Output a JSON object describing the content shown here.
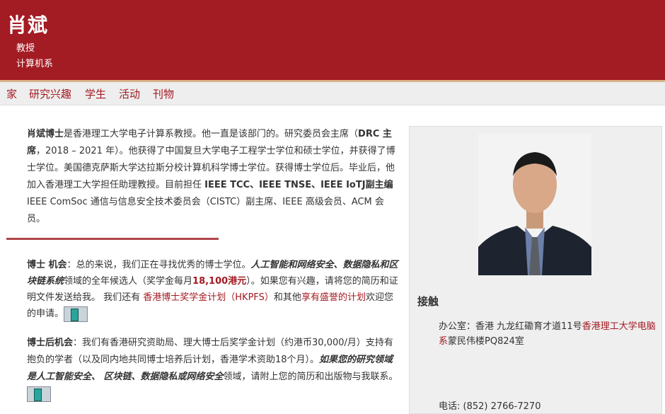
{
  "header": {
    "name": "肖斌",
    "title": "教授",
    "department": "计算机系"
  },
  "nav": [
    "家",
    "研究兴趣",
    "学生",
    "活动",
    "刊物"
  ],
  "bio": {
    "name_bold": "肖斌博士",
    "t1": "是香港理工大学电子计算系教授。他一直是该部门的。研究委员会主席（",
    "drc": "DRC 主席",
    "t2": "，2018 – 2021 年）。他获得了中国复旦大学电子工程学士学位和硕士学位，并获得了博士学位。美国德克萨斯大学达拉斯分校计算机科学博士学位。获得博士学位后。毕业后，他加入香港理工大学担任助理教授。目前担任 ",
    "ieee": "IEEE TCC、IEEE TNSE、IEEE IoTJ副主编",
    "t3": "IEEE ComSoc 通信与信息安全技术委员会（CISTC）副主席、IEEE 高级会员、ACM 会员。"
  },
  "phd": {
    "label": "博士 机会",
    "t1": "：总的来说，我们正在寻找优秀的博士学位。",
    "emph": "人工智能和网络安全、数据隐私和区块链系统",
    "t2": "领域的全年候选人（奖学金每月",
    "amount": "18,100港元",
    "t3": "）。如果您有兴趣，请将您的简历和证明文件发送给我。 我们还有 ",
    "link1": "香港博士奖学金计划（HKPFS）",
    "t4": "和其他",
    "link2": "享有盛誉的计划",
    "t5": "欢迎您的申请。"
  },
  "postdoc": {
    "label": "博士后机会",
    "t1": "：我们有香港研究资助局、理大博士后奖学金计划（约港币30,000/月）支持有抱负的学者（以及同内地共同博士培养后计划，香港学术资助18个月）。",
    "emph": "如果您的研究领域是人工智能安全、 区块链、数据隐私或网络安全",
    "t2": "领域，请附上您的简历和出版物与我联系。"
  },
  "sidebar": {
    "contact_heading": "接触",
    "office_prefix": "办公室：香港 九龙红磡育才道11号",
    "office_link": "香港理工大学电脑系",
    "office_suffix": "蒙民伟楼PQ824室",
    "phone": "电话: (852) 2766-7270"
  },
  "colors": {
    "brand": "#a31b23",
    "accent_line": "#d9b48a"
  }
}
